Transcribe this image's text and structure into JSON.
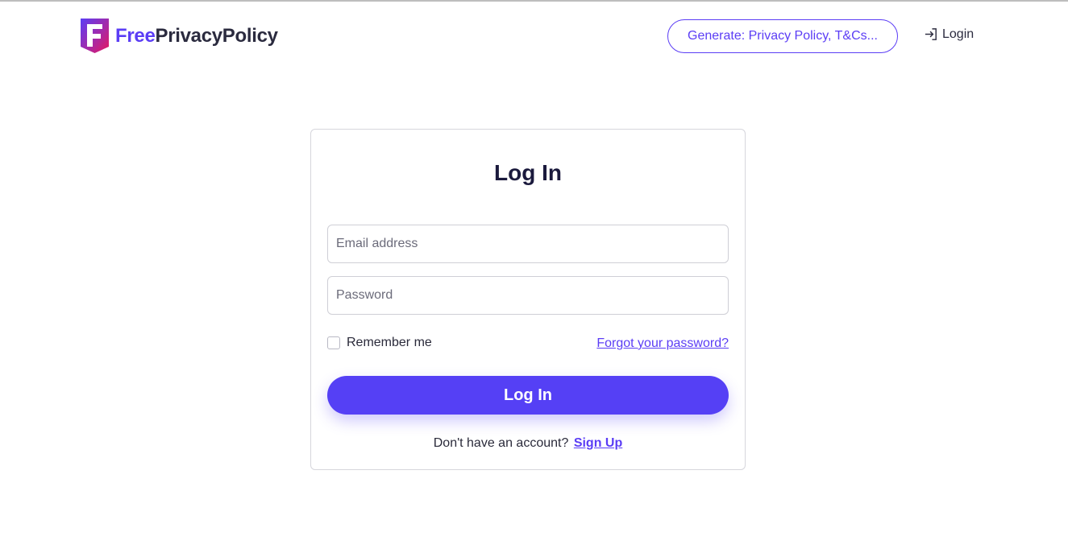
{
  "brand": {
    "name_part1": "Free",
    "name_part2": "PrivacyPolicy",
    "logo_icon": "shield-f-logo-icon",
    "colors": {
      "primary": "#5b3df5",
      "accent": "#e8175d",
      "text": "#2b2b3f"
    }
  },
  "header": {
    "generate_label": "Generate: Privacy Policy, T&Cs...",
    "login_label": "Login",
    "login_icon": "sign-in-icon"
  },
  "form": {
    "title": "Log In",
    "email_placeholder": "Email address",
    "email_value": "",
    "password_placeholder": "Password",
    "password_value": "",
    "remember_label": "Remember me",
    "remember_checked": false,
    "forgot_label": "Forgot your password?",
    "submit_label": "Log In",
    "signup_prompt": "Don't have an account?",
    "signup_label": "Sign Up"
  }
}
